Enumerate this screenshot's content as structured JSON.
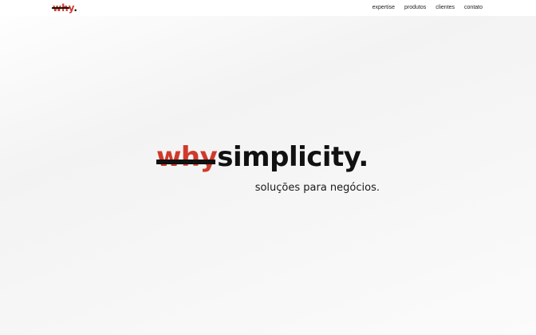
{
  "header": {
    "logo": {
      "strike_text": "wh",
      "accent_text": "y",
      "dot": "."
    },
    "nav": [
      {
        "label": "expertise"
      },
      {
        "label": "produtos"
      },
      {
        "label": "clientes"
      },
      {
        "label": "contato"
      }
    ]
  },
  "hero": {
    "strike_text": "why",
    "word": "simplicity",
    "dot": ".",
    "tagline": "soluções para negócios."
  },
  "colors": {
    "accent": "#d03a2c",
    "text": "#111111",
    "header_bg": "#ffffff",
    "page_bg": "#f4f4f4"
  }
}
